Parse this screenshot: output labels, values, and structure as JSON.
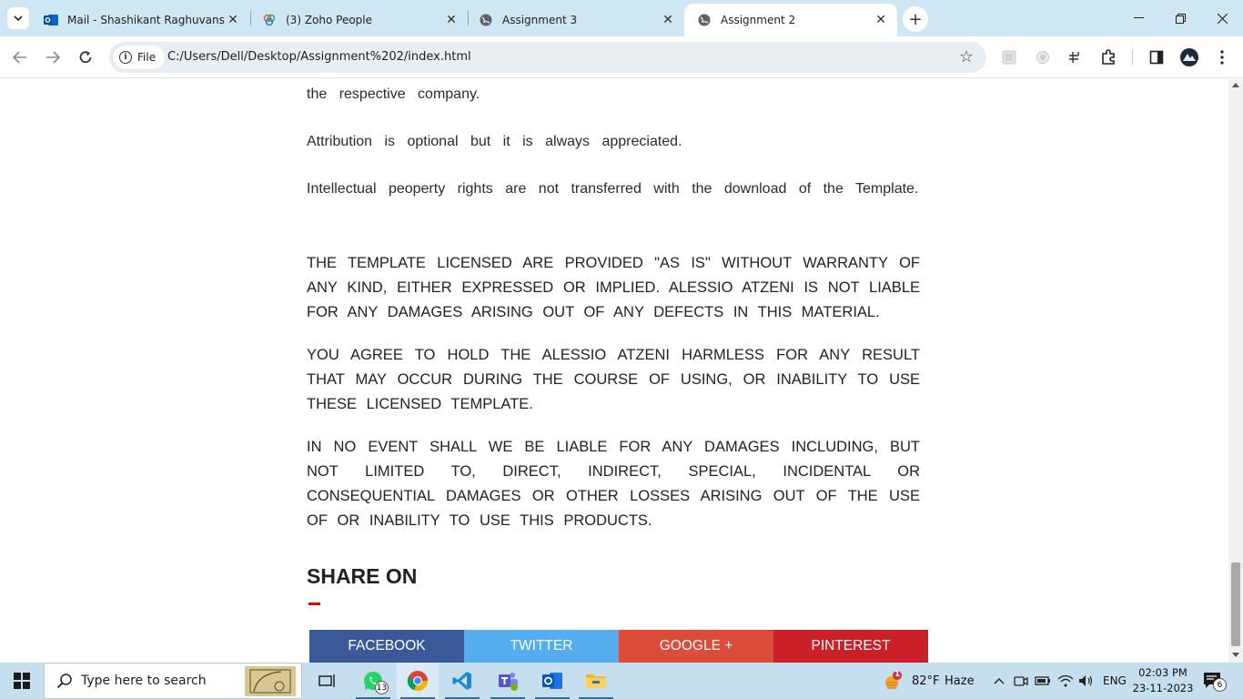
{
  "browser": {
    "tabs": [
      {
        "title": "Mail - Shashikant Raghuvanshi",
        "icon": "outlook-icon",
        "active": false
      },
      {
        "title": "(3) Zoho People",
        "icon": "zoho-icon",
        "active": false
      },
      {
        "title": "Assignment 3",
        "icon": "globe-icon",
        "active": false
      },
      {
        "title": "Assignment 2",
        "icon": "globe-icon",
        "active": true
      }
    ],
    "address": {
      "scheme_label": "File",
      "url": "C:/Users/Dell/Desktop/Assignment%202/index.html"
    }
  },
  "page": {
    "paragraphs": [
      "the respective company.",
      "Attribution is optional but it is always appreciated.",
      "Intellectual peoperty rights are not transferred with the download of the Template."
    ],
    "legal": [
      "THE TEMPLATE LICENSED ARE PROVIDED \"AS IS\" WITHOUT WARRANTY OF ANY KIND, EITHER EXPRESSED OR IMPLIED. ALESSIO ATZENI IS NOT LIABLE FOR ANY DAMAGES ARISING OUT OF ANY DEFECTS IN THIS MATERIAL.",
      "YOU AGREE TO HOLD THE ALESSIO ATZENI HARMLESS FOR ANY RESULT THAT MAY OCCUR DURING THE COURSE OF USING, OR INABILITY TO USE THESE LICENSED TEMPLATE.",
      "IN NO EVENT SHALL WE BE LIABLE FOR ANY DAMAGES INCLUDING, BUT NOT LIMITED TO, DIRECT, INDIRECT, SPECIAL, INCIDENTAL OR CONSEQUENTIAL DAMAGES OR OTHER LOSSES ARISING OUT OF THE USE OF OR INABILITY TO USE THIS PRODUCTS."
    ],
    "share": {
      "title": "SHARE ON",
      "buttons": [
        {
          "label": "FACEBOOK",
          "color": "#3b5998"
        },
        {
          "label": "TWITTER",
          "color": "#55acee"
        },
        {
          "label": "GOOGLE +",
          "color": "#dd4b39"
        },
        {
          "label": "PINTEREST",
          "color": "#cb2027"
        }
      ]
    }
  },
  "taskbar": {
    "search_placeholder": "Type here to search",
    "whatsapp_badge": "13",
    "weather": {
      "temp": "82°F",
      "condition": "Haze",
      "alert": "1"
    },
    "language": "ENG",
    "time": "02:03 PM",
    "date": "23-11-2023",
    "notification_count": "6"
  }
}
